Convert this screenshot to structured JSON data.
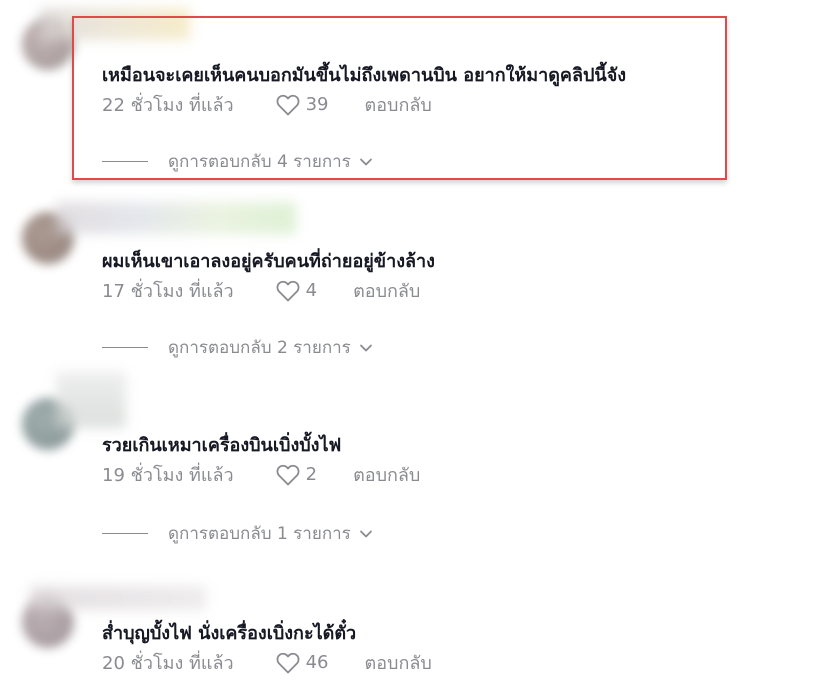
{
  "comments": [
    {
      "text": "เหมือนจะเคยเห็นคนบอกมันขึ้นไม่ถึงเพดานบิน อยากให้มาดูคลิปนี้จัง",
      "time": "22 ชั่วโมง ที่แล้ว",
      "likes": "39",
      "reply": "ตอบกลับ",
      "view_replies": "ดูการตอบกลับ 4 รายการ"
    },
    {
      "text": "ผมเห็นเขาเอาลงอยู่ครับคนที่ถ่ายอยู่ข้างล้าง",
      "time": "17 ชั่วโมง ที่แล้ว",
      "likes": "4",
      "reply": "ตอบกลับ",
      "view_replies": "ดูการตอบกลับ 2 รายการ"
    },
    {
      "text": "รวยเกินเหมาเครื่องบินเบิ่งบั้งไฟ",
      "time": "19 ชั่วโมง ที่แล้ว",
      "likes": "2",
      "reply": "ตอบกลับ",
      "view_replies": "ดูการตอบกลับ 1 รายการ"
    },
    {
      "text": "ส่ำบุญบั้งไฟ นั่งเครื่องเบิ่งกะได้ตั๋ว",
      "time": "20 ชั่วโมง ที่แล้ว",
      "likes": "46",
      "reply": "ตอบกลับ"
    }
  ],
  "colors": {
    "text": "#161823",
    "muted": "#8a8b91",
    "highlight": "#e14a4a"
  }
}
